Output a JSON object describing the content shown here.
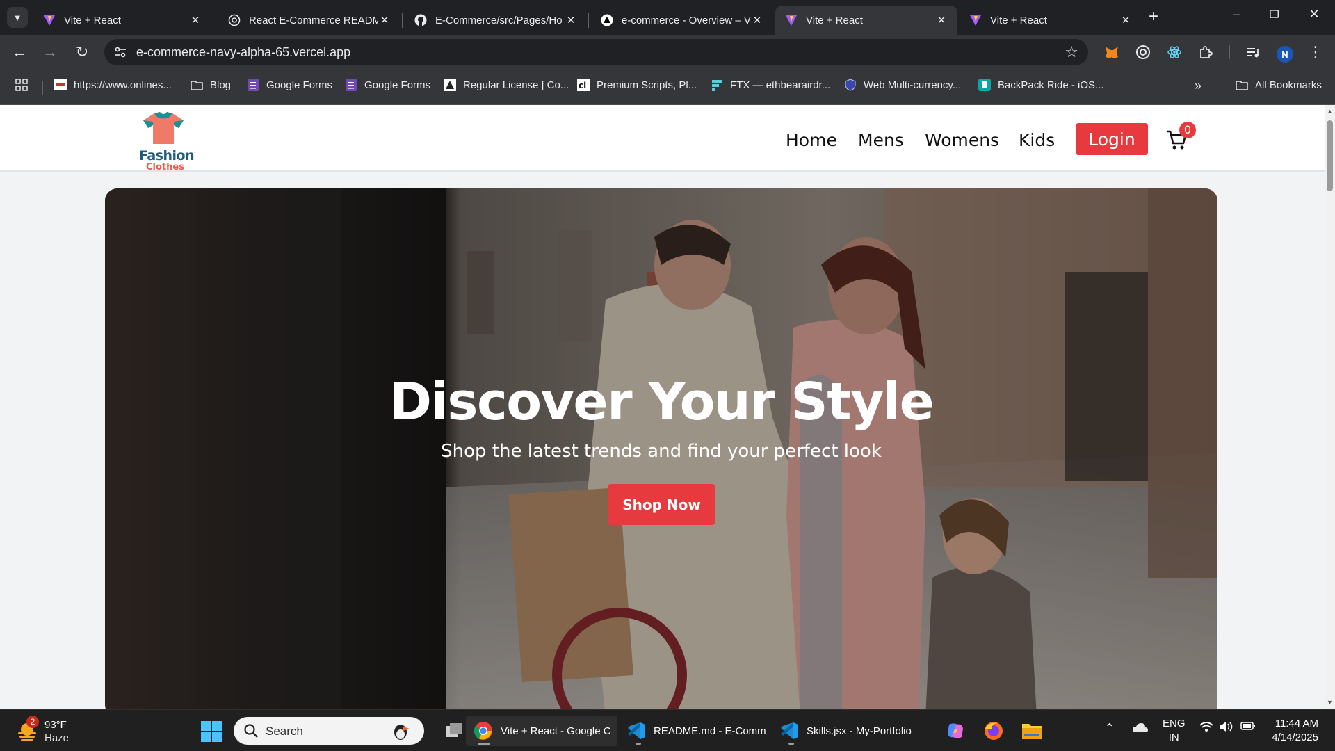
{
  "tabs": [
    {
      "title": "Vite + React",
      "icon": "vite-icon",
      "active": false
    },
    {
      "title": "React E-Commerce READM",
      "icon": "chatgpt-icon",
      "active": false
    },
    {
      "title": "E-Commerce/src/Pages/Ho",
      "icon": "github-icon",
      "active": false
    },
    {
      "title": "e-commerce - Overview – V",
      "icon": "vercel-icon",
      "active": false
    },
    {
      "title": "Vite + React",
      "icon": "vite-icon",
      "active": true
    },
    {
      "title": "Vite + React",
      "icon": "vite-icon",
      "active": false
    }
  ],
  "toolbar": {
    "url": "e-commerce-navy-alpha-65.vercel.app",
    "profile_initial": "N"
  },
  "bookmarks": [
    {
      "label": "https://www.onlines...",
      "icon": "site-icon"
    },
    {
      "label": "Blog",
      "icon": "folder-icon"
    },
    {
      "label": "Google Forms",
      "icon": "google-forms-icon"
    },
    {
      "label": "Google Forms",
      "icon": "google-forms-icon"
    },
    {
      "label": "Regular License | Co...",
      "icon": "envato-icon"
    },
    {
      "label": "Premium Scripts, Pl...",
      "icon": "codecanyon-icon"
    },
    {
      "label": "FTX — ethbearairdr...",
      "icon": "ftx-icon"
    },
    {
      "label": "Web Multi-currency...",
      "icon": "shield-icon"
    },
    {
      "label": "BackPack Ride - iOS...",
      "icon": "app-icon"
    }
  ],
  "bookmarks_all": "All Bookmarks",
  "site": {
    "logo_top": "Fashion",
    "logo_bottom": "Clothes",
    "nav": [
      "Home",
      "Mens",
      "Womens",
      "Kids"
    ],
    "login": "Login",
    "cart_count": "0",
    "hero_title": "Discover Your Style",
    "hero_subtitle": "Shop the latest trends and find your perfect look",
    "hero_button": "Shop Now"
  },
  "taskbar": {
    "weather_temp": "93°F",
    "weather_desc": "Haze",
    "weather_badge": "2",
    "search_placeholder": "Search",
    "apps": [
      {
        "label": "Vite + React - Google C",
        "icon": "chrome-icon",
        "active": true
      },
      {
        "label": "README.md - E-Comm",
        "icon": "vscode-icon",
        "active": false
      },
      {
        "label": "Skills.jsx - My-Portfolio",
        "icon": "vscode-icon",
        "active": false
      }
    ],
    "lang_top": "ENG",
    "lang_bottom": "IN",
    "time": "11:44 AM",
    "date": "4/14/2025"
  },
  "colors": {
    "accent_red": "#e63a3f",
    "chrome_dark": "#202124",
    "chrome_mid": "#35363a"
  }
}
